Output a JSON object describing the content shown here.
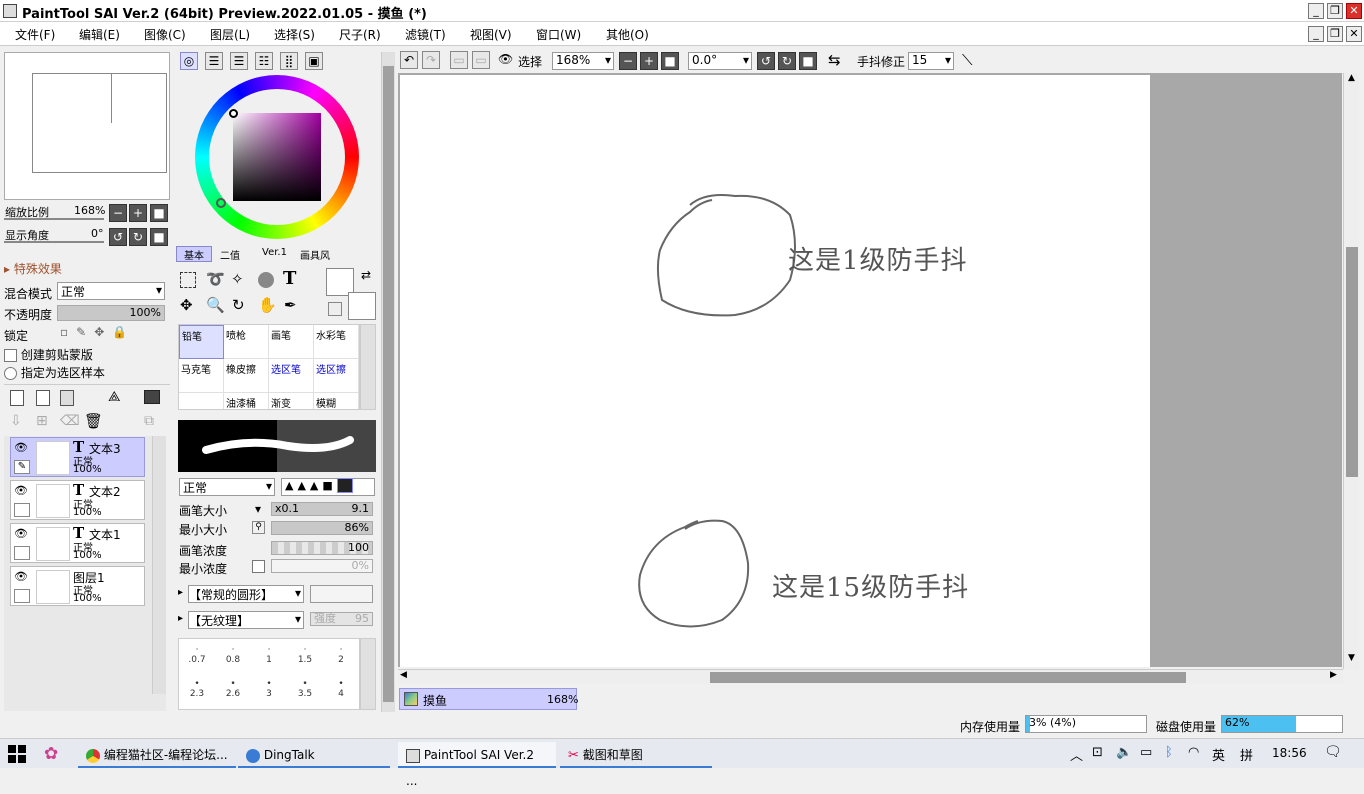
{
  "window": {
    "title": "PaintTool SAI Ver.2 (64bit) Preview.2022.01.05 - 摸鱼 (*)"
  },
  "menu": [
    "文件(F)",
    "编辑(E)",
    "图像(C)",
    "图层(L)",
    "选择(S)",
    "尺子(R)",
    "滤镜(T)",
    "视图(V)",
    "窗口(W)",
    "其他(O)"
  ],
  "navigator": {
    "zoom_label": "缩放比例",
    "zoom_value": "168%",
    "angle_label": "显示角度",
    "angle_value": "0°"
  },
  "layer_props": {
    "section": "特殊效果",
    "blend_label": "混合模式",
    "blend_value": "正常",
    "opacity_label": "不透明度",
    "opacity_value": "100%",
    "lock_label": "锁定",
    "clip_label": "创建剪贴蒙版",
    "select_label": "指定为选区样本"
  },
  "layers": [
    {
      "name": "文本3",
      "mode": "正常",
      "opacity": "100%"
    },
    {
      "name": "文本2",
      "mode": "正常",
      "opacity": "100%"
    },
    {
      "name": "文本1",
      "mode": "正常",
      "opacity": "100%"
    },
    {
      "name": "图层1",
      "mode": "正常",
      "opacity": "100%"
    }
  ],
  "color_tabs": [
    "基本",
    "二值",
    "Ver.1",
    "画具风"
  ],
  "tools": [
    {
      "name": "铅笔"
    },
    {
      "name": "喷枪"
    },
    {
      "name": "画笔"
    },
    {
      "name": "水彩笔"
    },
    {
      "name": "马克笔"
    },
    {
      "name": "橡皮擦"
    },
    {
      "name": "选区笔"
    },
    {
      "name": "选区擦"
    },
    {
      "name": ""
    },
    {
      "name": "油漆桶"
    },
    {
      "name": "渐变"
    },
    {
      "name": "模糊"
    }
  ],
  "brush": {
    "mode": "正常",
    "size_label": "画笔大小",
    "size_mult": "x0.1",
    "size_value": "9.1",
    "min_size_label": "最小大小",
    "min_size_value": "86%",
    "density_label": "画笔浓度",
    "density_value": "100",
    "min_density_label": "最小浓度",
    "min_density_value": "0%",
    "shape": "【常规的圆形】",
    "texture": "【无纹理】",
    "strength": "强度",
    "strength_value": "95"
  },
  "brush_sizes": [
    ".0.7",
    "0.8",
    "1",
    "1.5",
    "2",
    "2.3",
    "2.6",
    "3",
    "3.5",
    "4"
  ],
  "toolbar": {
    "select_label": "选择",
    "zoom": "168%",
    "angle": "0.0°",
    "stab_label": "手抖修正",
    "stab_value": "15"
  },
  "canvas": {
    "text1": "这是1级防手抖",
    "text2": "这是15级防手抖"
  },
  "doc_tab": {
    "name": "摸鱼",
    "zoom": "168%"
  },
  "status": {
    "mem_label": "内存使用量",
    "mem_value": "3% (4%)",
    "disk_label": "磁盘使用量",
    "disk_value": "62%",
    "disk_fraction": 0.62
  },
  "taskbar": {
    "items": [
      "编程猫社区-编程论坛...",
      "DingTalk",
      "PaintTool SAI Ver.2 ...",
      "截图和草图"
    ],
    "ime": "英",
    "ime2": "拼",
    "time": "18:56"
  },
  "colors": {
    "accent": "#3a7bd5",
    "selected_layer": "#ccccff"
  }
}
